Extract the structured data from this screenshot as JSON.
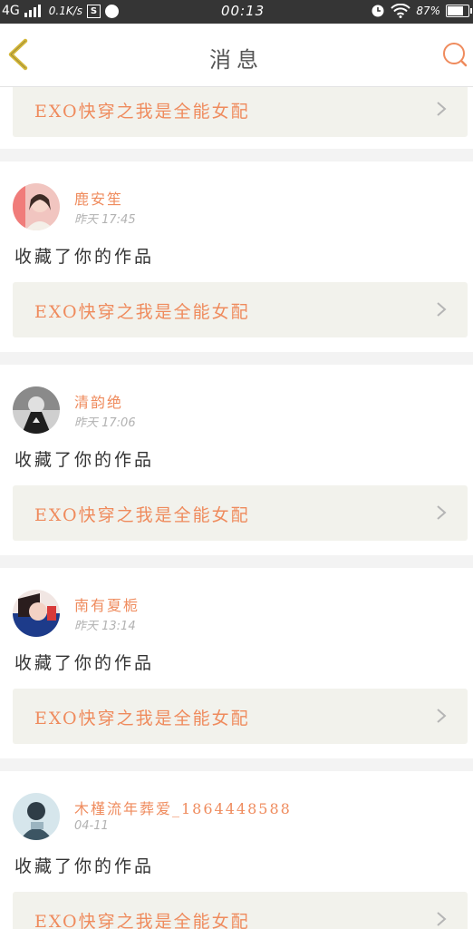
{
  "status_bar": {
    "network": "4G",
    "speed": "0.1K/s",
    "time": "00:13",
    "battery": "87%",
    "battery_level": 0.87
  },
  "header": {
    "title": "消息",
    "back_icon": "chevron-left-icon",
    "search_icon": "search-icon"
  },
  "colors": {
    "accent": "#ef8b5d",
    "back": "#d5b83a",
    "card_bg": "#ffffff",
    "link_bg": "#f2f2ec",
    "page_bg": "#f3f3f3"
  },
  "messages": [
    {
      "work_title": "EXO快穿之我是全能女配"
    },
    {
      "user": "鹿安笙",
      "time": "昨天 17:45",
      "action": "收藏了你的作品",
      "work_title": "EXO快穿之我是全能女配"
    },
    {
      "user": "清韵绝",
      "time": "昨天 17:06",
      "action": "收藏了你的作品",
      "work_title": "EXO快穿之我是全能女配"
    },
    {
      "user": "南有夏栀",
      "time": "昨天 13:14",
      "action": "收藏了你的作品",
      "work_title": "EXO快穿之我是全能女配"
    },
    {
      "user": "木槿流年葬爱_1864448588",
      "time": "04-11",
      "action": "收藏了你的作品",
      "work_title": "EXO快穿之我是全能女配"
    }
  ]
}
